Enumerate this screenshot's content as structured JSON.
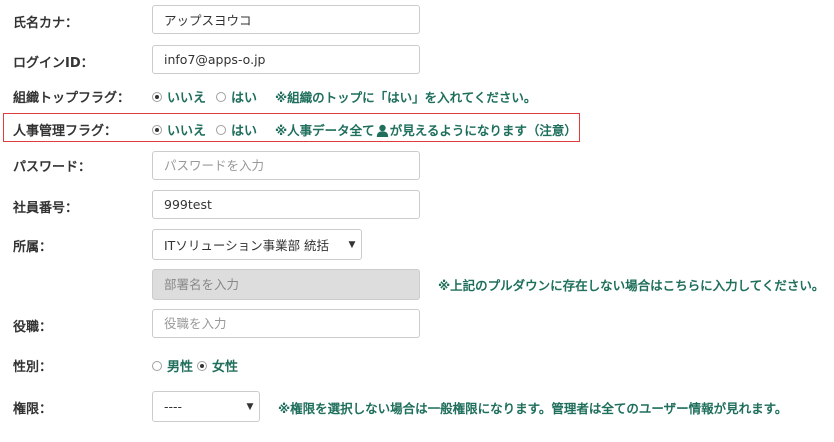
{
  "fields": {
    "kana": {
      "label": "氏名カナ：",
      "value": "アップスヨウコ"
    },
    "login": {
      "label": "ログインID：",
      "value": "info7@apps-o.jp"
    },
    "org_top_flag": {
      "label": "組織トップフラグ：",
      "option_no": "いいえ",
      "option_yes": "はい",
      "selected": "いいえ",
      "note": "※組織のトップに「はい」を入れてください。"
    },
    "hr_flag": {
      "label": "人事管理フラグ：",
      "option_no": "いいえ",
      "option_yes": "はい",
      "selected": "いいえ",
      "note_before": "※人事データ全て",
      "note_icon": "person-icon",
      "note_after": "が見えるようになります（注意）"
    },
    "password": {
      "label": "パスワード：",
      "placeholder": "パスワードを入力"
    },
    "employee_no": {
      "label": "社員番号：",
      "value": "999test"
    },
    "department": {
      "label": "所属：",
      "selected": "ITソリューション事業部 統括",
      "placeholder": "部署名を入力",
      "note": "※上記のプルダウンに存在しない場合はこちらに入力してください。"
    },
    "position": {
      "label": "役職：",
      "placeholder": "役職を入力"
    },
    "gender": {
      "label": "性別：",
      "option_male": "男性",
      "option_female": "女性",
      "selected": "女性"
    },
    "authority": {
      "label": "権限：",
      "selected": "----",
      "note": "※権限を選択しない場合は一般権限になります。管理者は全てのユーザー情報が見れます。"
    }
  },
  "colors": {
    "note_text": "#1f6f5c",
    "highlight_border": "#e03c3c"
  }
}
